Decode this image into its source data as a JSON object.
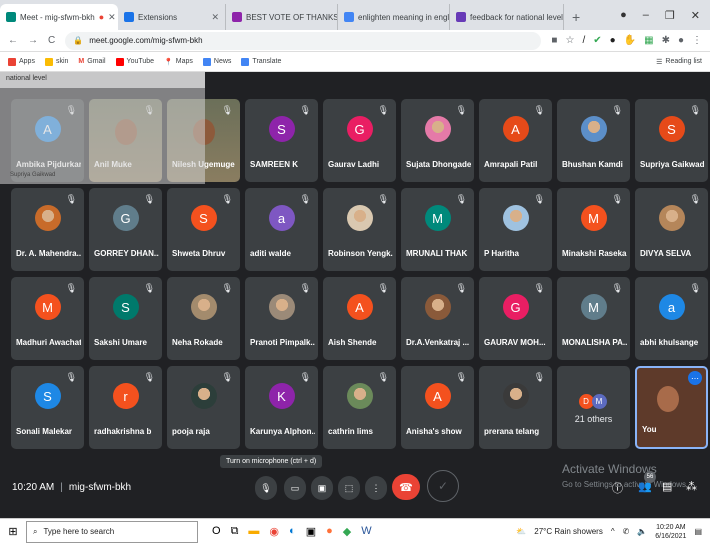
{
  "tabs": [
    {
      "label": "Meet - mig-sfwm-bkh",
      "color": "#00897b",
      "active": true
    },
    {
      "label": "Extensions",
      "color": "#1a73e8"
    },
    {
      "label": "BEST VOTE OF THANKS SPEE",
      "color": "#8e24aa"
    },
    {
      "label": "enlighten meaning in englis",
      "color": "#4285f4"
    },
    {
      "label": "feedback for national level li",
      "color": "#673ab7"
    }
  ],
  "address": {
    "url": "meet.google.com/mig-sfwm-bkh"
  },
  "bookmarks": [
    {
      "label": "Apps",
      "color": "#ea4335"
    },
    {
      "label": "skin",
      "color": "#fbbc04"
    },
    {
      "label": "Gmail",
      "color": "#ea4335"
    },
    {
      "label": "YouTube",
      "color": "#ff0000"
    },
    {
      "label": "Maps",
      "color": "#34a853"
    },
    {
      "label": "News",
      "color": "#4285f4"
    },
    {
      "label": "Translate",
      "color": "#4285f4"
    }
  ],
  "reading_list": "Reading list",
  "overlay": {
    "title": "national level",
    "line": "Supriya Gaikwad"
  },
  "participants": [
    {
      "name": "Ambika Pijdurkar",
      "initial": "A",
      "color": "#1e88e5"
    },
    {
      "name": "Anil Muke",
      "initial": "",
      "color": "#7b6b4f"
    },
    {
      "name": "Nilesh Ugemuge",
      "initial": "",
      "color": "#6b5a48"
    },
    {
      "name": "SAMREEN K",
      "initial": "S",
      "color": "#8e24aa"
    },
    {
      "name": "Gaurav Ladhi",
      "initial": "G",
      "color": "#e91e63"
    },
    {
      "name": "Sujata Dhongade",
      "initial": "",
      "color": "#e57aa8"
    },
    {
      "name": "Amrapali Patil",
      "initial": "A",
      "color": "#e64a19"
    },
    {
      "name": "Bhushan Kamdi",
      "initial": "",
      "color": "#5c8fc9"
    },
    {
      "name": "Supriya Gaikwad",
      "initial": "S",
      "color": "#e64a19"
    },
    {
      "name": "Dr. A. Mahendra...",
      "initial": "",
      "color": "#c86b2a"
    },
    {
      "name": "GORREY DHAN...",
      "initial": "G",
      "color": "#607d8b"
    },
    {
      "name": "Shweta Dhruv",
      "initial": "S",
      "color": "#f4511e"
    },
    {
      "name": "aditi walde",
      "initial": "a",
      "color": "#7e57c2"
    },
    {
      "name": "Robinson Yengk...",
      "initial": "",
      "color": "#d9c8b0"
    },
    {
      "name": "MRUNALI THAK",
      "initial": "M",
      "color": "#00897b"
    },
    {
      "name": "P Haritha",
      "initial": "",
      "color": "#9fc2e0"
    },
    {
      "name": "Minakshi Rasekar",
      "initial": "M",
      "color": "#f4511e"
    },
    {
      "name": "DIVYA SELVA",
      "initial": "",
      "color": "#b5865a"
    },
    {
      "name": "Madhuri Awachat",
      "initial": "M",
      "color": "#f4511e"
    },
    {
      "name": "Sakshi Umare",
      "initial": "S",
      "color": "#00796b"
    },
    {
      "name": "Neha Rokade",
      "initial": "",
      "color": "#a38b6d"
    },
    {
      "name": "Pranoti Pimpalk...",
      "initial": "",
      "color": "#9b8a78"
    },
    {
      "name": "Aish Shende",
      "initial": "A",
      "color": "#f4511e"
    },
    {
      "name": "Dr.A.Venkatraj ...",
      "initial": "",
      "color": "#8a5a3a"
    },
    {
      "name": "GAURAV MOH...",
      "initial": "G",
      "color": "#e91e63"
    },
    {
      "name": "MONALISHA PA...",
      "initial": "M",
      "color": "#607d8b"
    },
    {
      "name": "abhi khulsange",
      "initial": "a",
      "color": "#1e88e5"
    },
    {
      "name": "Sonali Malekar",
      "initial": "S",
      "color": "#1e88e5"
    },
    {
      "name": "radhakrishna b",
      "initial": "r",
      "color": "#f4511e"
    },
    {
      "name": "pooja raja",
      "initial": "",
      "color": "#2c3e3a"
    },
    {
      "name": "Karunya Alphon...",
      "initial": "K",
      "color": "#8e24aa"
    },
    {
      "name": "cathrin lims",
      "initial": "",
      "color": "#6b8a5a"
    },
    {
      "name": "Anisha's show",
      "initial": "A",
      "color": "#f4511e"
    },
    {
      "name": "prerana telang",
      "initial": "",
      "color": "#3a3a3a"
    }
  ],
  "others": {
    "label": "21 others",
    "avatars": [
      {
        "initial": "D",
        "color": "#f4511e"
      },
      {
        "initial": "M",
        "color": "#5c6bc0"
      }
    ]
  },
  "self": {
    "label": "You"
  },
  "bottom": {
    "time": "10:20 AM",
    "meeting_code": "mig-sfwm-bkh",
    "tooltip": "Turn on microphone (ctrl + d)",
    "participants_count": "56",
    "activate_title": "Activate Windows",
    "activate_sub": "Go to Settings to activate Windows."
  },
  "taskbar": {
    "search_placeholder": "Type here to search",
    "weather": "27°C Rain showers",
    "clock_time": "10:20 AM",
    "clock_date": "6/16/2021"
  }
}
